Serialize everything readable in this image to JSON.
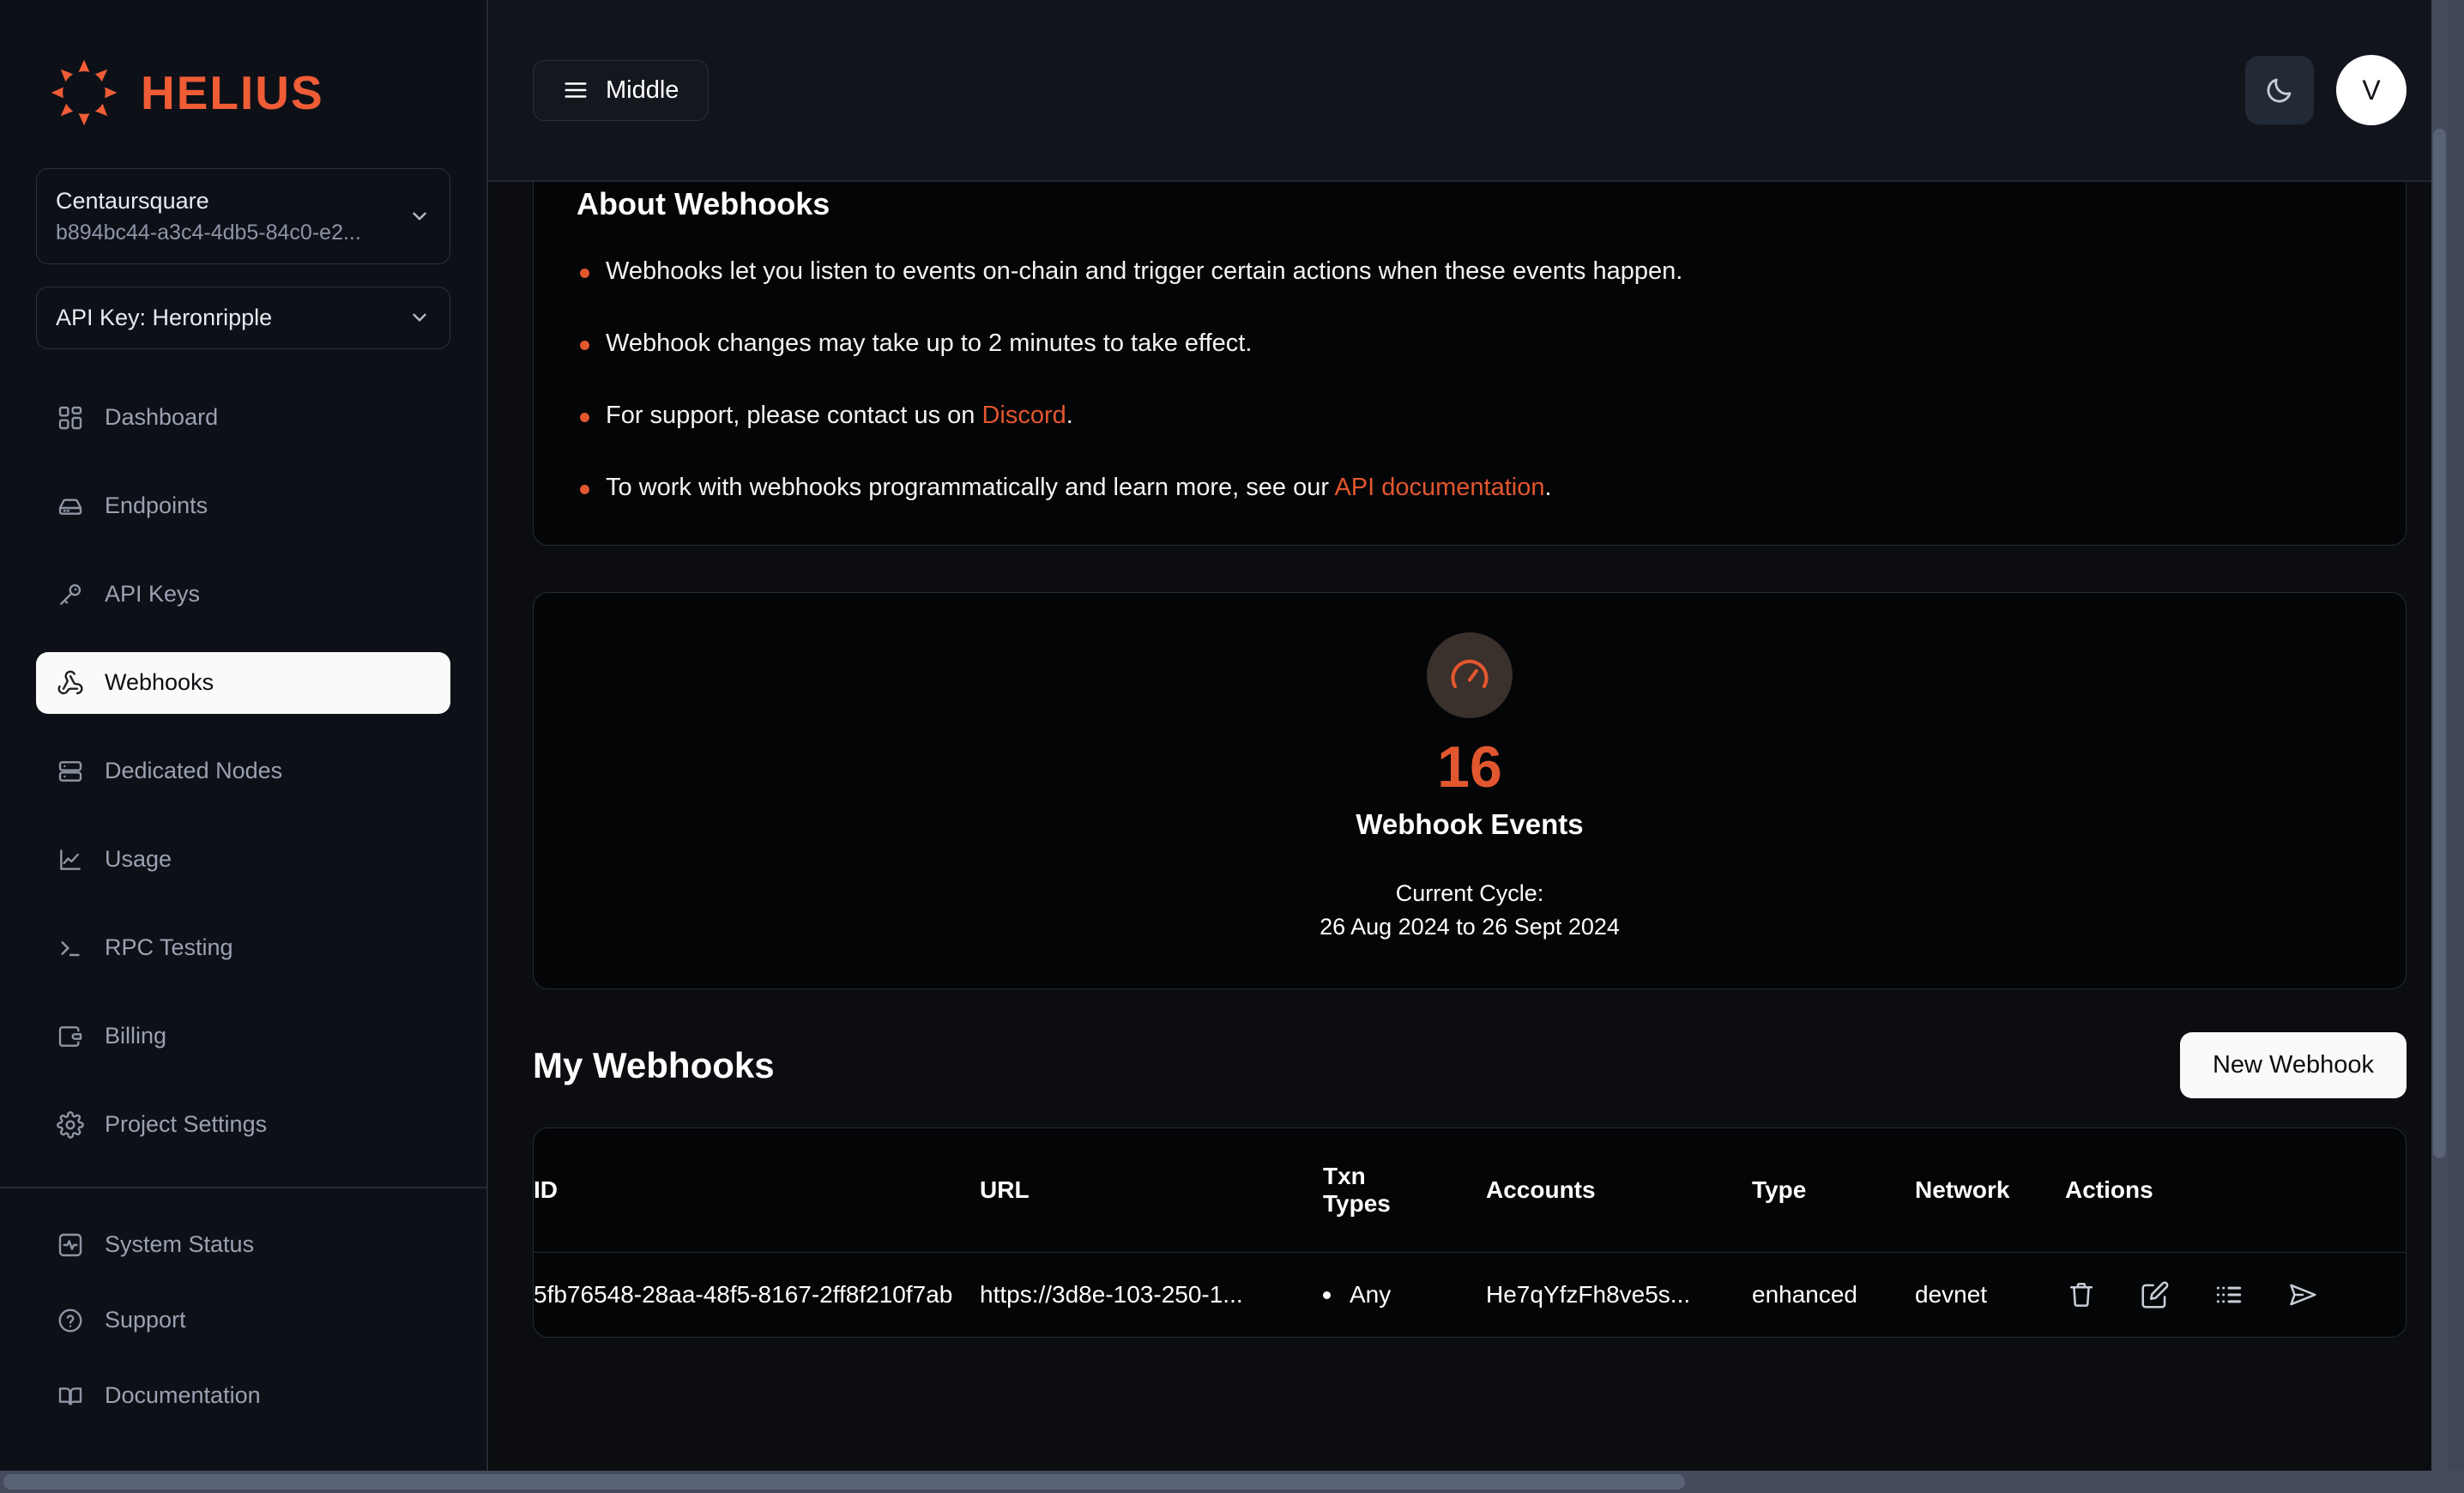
{
  "brand": {
    "name": "HELIUS",
    "accent": "#ef5c36",
    "logo_icon": "helius-sun-logo"
  },
  "sidebar": {
    "project_selector": {
      "name": "Centaursquare",
      "id": "b894bc44-a3c4-4db5-84c0-e2...",
      "chevron_icon": "chevron-down-icon"
    },
    "api_key_selector": {
      "label": "API Key: Heronripple",
      "chevron_icon": "chevron-down-icon"
    },
    "items": [
      {
        "label": "Dashboard",
        "icon": "grid-dashboard-icon",
        "active": false
      },
      {
        "label": "Endpoints",
        "icon": "server-endpoint-icon",
        "active": false
      },
      {
        "label": "API Keys",
        "icon": "key-icon",
        "active": false
      },
      {
        "label": "Webhooks",
        "icon": "webhook-icon",
        "active": true
      },
      {
        "label": "Dedicated Nodes",
        "icon": "server-stack-icon",
        "active": false
      },
      {
        "label": "Usage",
        "icon": "line-chart-icon",
        "active": false
      },
      {
        "label": "RPC Testing",
        "icon": "terminal-icon",
        "active": false
      },
      {
        "label": "Billing",
        "icon": "wallet-icon",
        "active": false
      },
      {
        "label": "Project Settings",
        "icon": "gear-icon",
        "active": false
      }
    ],
    "lower_items": [
      {
        "label": "System Status",
        "icon": "activity-square-icon"
      },
      {
        "label": "Support",
        "icon": "question-circle-icon"
      },
      {
        "label": "Documentation",
        "icon": "book-open-icon"
      }
    ]
  },
  "topbar": {
    "menu_button": {
      "label": "Middle",
      "icon": "hamburger-menu-icon"
    },
    "theme_toggle_icon": "moon-icon",
    "avatar_initial": "V"
  },
  "about": {
    "title": "About Webhooks",
    "bullets": [
      {
        "prefix": "Webhooks let you listen to events on-chain and trigger certain actions when these events happen.",
        "link": "",
        "suffix": ""
      },
      {
        "prefix": "Webhook changes may take up to 2 minutes to take effect.",
        "link": "",
        "suffix": ""
      },
      {
        "prefix": "For support, please contact us on ",
        "link": "Discord",
        "suffix": "."
      },
      {
        "prefix": "To work with webhooks programmatically and learn more, see our ",
        "link": "API documentation",
        "suffix": "."
      }
    ]
  },
  "stats": {
    "gauge_icon": "gauge-speedometer-icon",
    "value": "16",
    "label": "Webhook Events",
    "cycle_label": "Current Cycle:",
    "cycle_range": "26 Aug 2024 to 26 Sept 2024",
    "accent": "#e2572f"
  },
  "webhooks": {
    "title": "My Webhooks",
    "new_button": "New Webhook",
    "columns": {
      "id": "ID",
      "url": "URL",
      "txn_types_line1": "Txn",
      "txn_types_line2": "Types",
      "accounts": "Accounts",
      "type": "Type",
      "network": "Network",
      "actions": "Actions"
    },
    "rows": [
      {
        "id": "5fb76548-28aa-48f5-8167-2ff8f210f7ab",
        "url": "https://3d8e-103-250-1...",
        "txn_type": "Any",
        "accounts": "He7qYfzFh8ve5s...",
        "type": "enhanced",
        "network": "devnet",
        "actions": [
          "delete-icon",
          "edit-icon",
          "list-icon",
          "send-icon"
        ]
      }
    ]
  }
}
